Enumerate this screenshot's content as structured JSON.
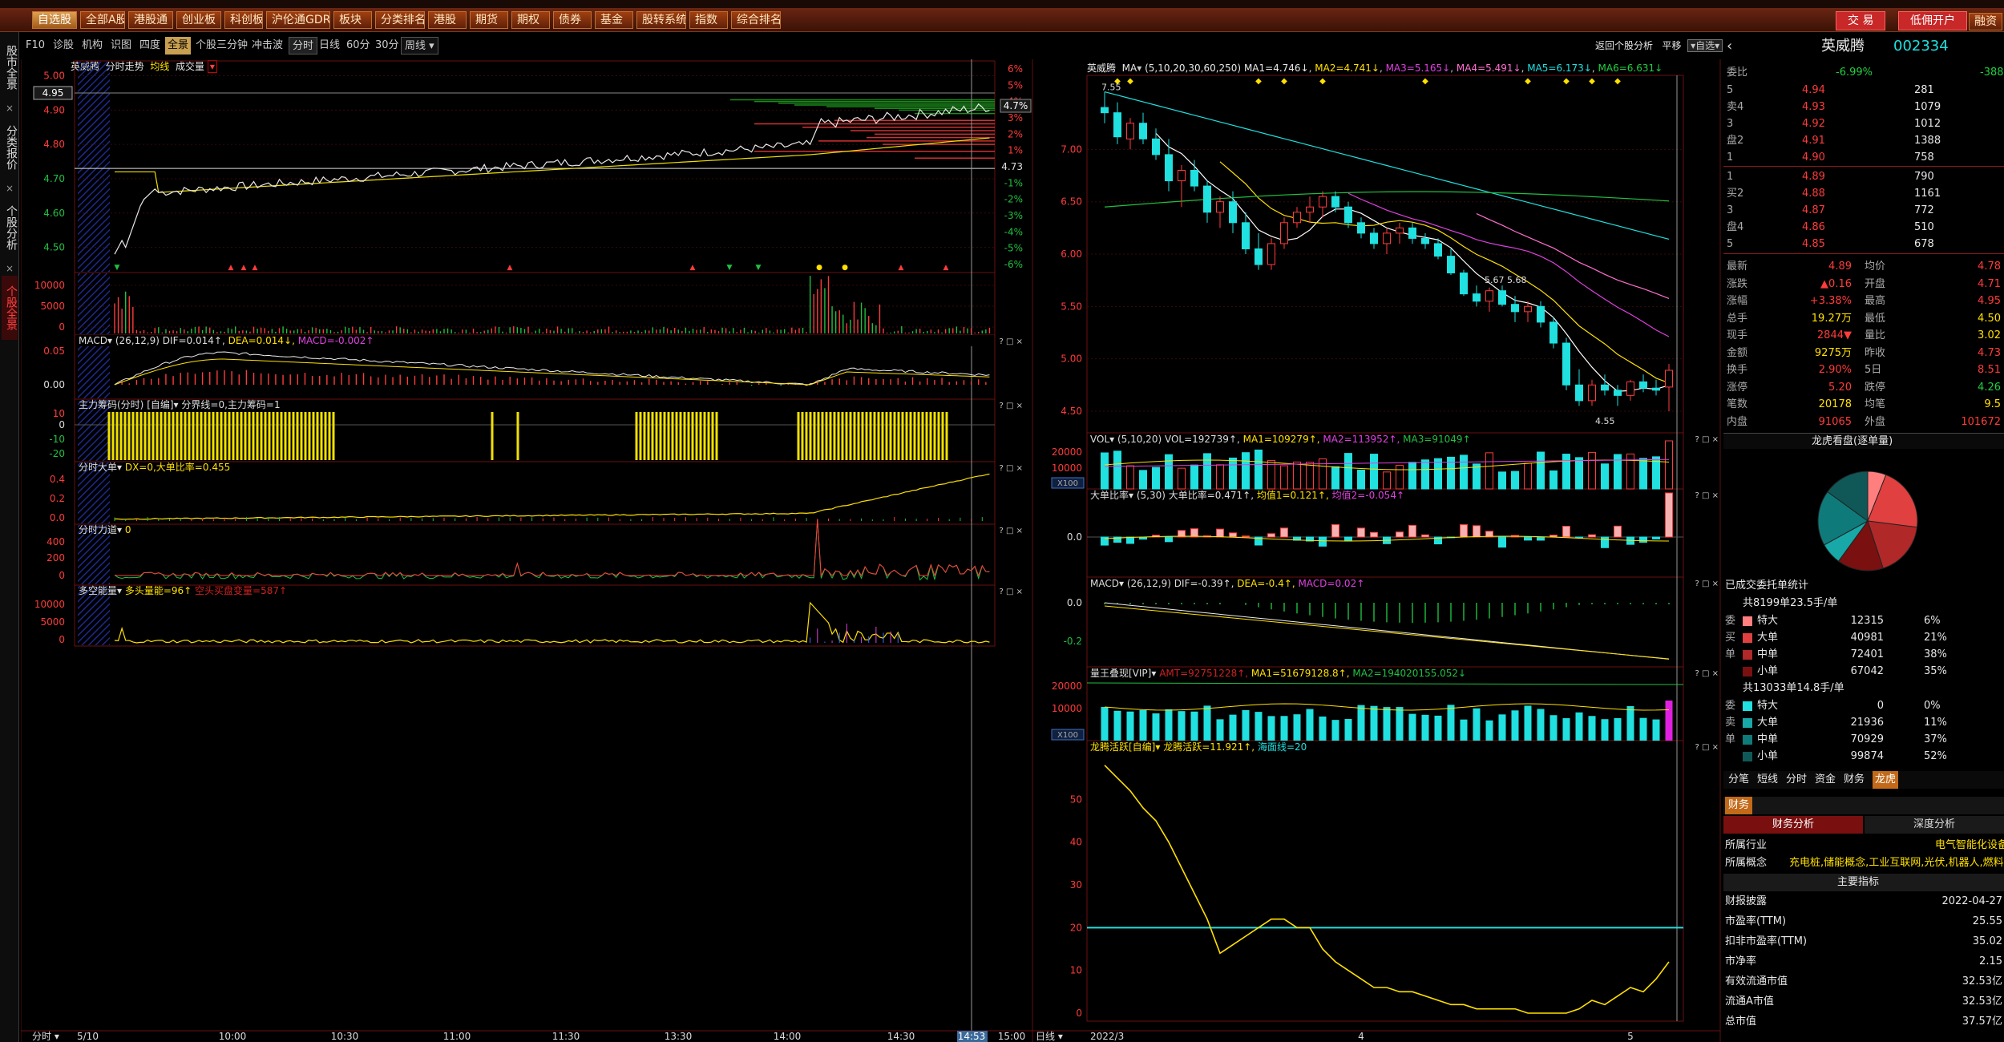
{
  "toolbar": {
    "items": [
      "自选股",
      "全部A股",
      "港股通",
      "创业板",
      "科创板",
      "沪伦通GDR",
      "板块",
      "分类排名",
      "港股",
      "期货",
      "期权",
      "债券",
      "基金",
      "股转系统",
      "指数",
      "综合排名"
    ],
    "trade": "交 易",
    "margin": "低佣开户",
    "right": "融资"
  },
  "leftside": {
    "tabs": [
      "股市全景",
      "分类报价",
      "个股分析",
      "个股全景"
    ]
  },
  "tabs": {
    "items": [
      "F10",
      "诊股",
      "机构",
      "识图",
      "四度",
      "全景",
      "个股三分钟",
      "冲击波"
    ],
    "periods": [
      "分时",
      "日线",
      "60分",
      "30分",
      "周线"
    ]
  },
  "intraday": {
    "title": {
      "name": "英威腾",
      "type": "分时走势",
      "avg": "均线",
      "vol": "成交量"
    },
    "left_ticks": [
      "5.00",
      "4.95",
      "4.90",
      "4.80",
      "4.70",
      "4.60",
      "4.50"
    ],
    "pct_ticks": [
      "6%",
      "5%",
      "4%",
      "3%",
      "2%",
      "1%",
      "4.73",
      "-1%",
      "-2%",
      "-3%",
      "-4%",
      "-5%",
      "-6%"
    ],
    "cur_price": "4.95",
    "cur_pct": "4.7%",
    "vol_ticks": [
      "10000",
      "5000",
      "0"
    ],
    "macd": {
      "name": "MACD",
      "params": "(26,12,9)",
      "dif": "DIF=0.014↑",
      "dea": "DEA=0.014↓",
      "macd": "MACD=-0.002↑",
      "ticks": [
        "0.05",
        "0.00"
      ]
    },
    "zlcm": {
      "name": "主力筹码(分时)",
      "badge": "[自编]",
      "text": "分界线=0,主力筹码=1",
      "ticks": [
        "10",
        "0",
        "-10",
        "-20"
      ]
    },
    "fsdd": {
      "name": "分时大单",
      "text": "DX=0,大单比率=0.455",
      "ticks": [
        "0.4",
        "0.2",
        "0.0"
      ]
    },
    "fsld": {
      "name": "分时力道",
      "text": "0",
      "ticks": [
        "400",
        "200",
        "0"
      ]
    },
    "dkn": {
      "name": "多空能量",
      "t1": "多头量能=96↑",
      "t2": "空头买盘变量=587↑",
      "ticks": [
        "10000",
        "5000",
        "0"
      ]
    },
    "time_ticks": [
      "分时",
      "5/10",
      "10:00",
      "10:30",
      "11:00",
      "11:30",
      "13:30",
      "14:00",
      "14:30",
      "14:53",
      "15:00"
    ]
  },
  "daily": {
    "ma": {
      "name": "英威腾",
      "label": "MA",
      "params": "(5,10,20,30,60,250)",
      "v": [
        "MA1=4.746↓",
        "MA2=4.741↓",
        "MA3=5.165↓",
        "MA4=5.491↓",
        "MA5=6.173↓",
        "MA6=6.631↓"
      ]
    },
    "right_title": {
      "back": "返回个股分析",
      "flat": "平移",
      "pick": "自选"
    },
    "price_ticks": [
      "7.00",
      "6.50",
      "6.00",
      "5.50",
      "5.00",
      "4.50"
    ],
    "hi_label": "7.55",
    "mark_label": "5.67  5.68",
    "lo_label": "4.55",
    "vol": {
      "name": "VOL",
      "params": "(5,10,20)",
      "v": [
        "VOL=192739↑",
        "MA1=109279↑",
        "MA2=113952↑",
        "MA3=91049↑"
      ],
      "ticks": [
        "20000",
        "10000",
        "0"
      ],
      "unit": "X100"
    },
    "ddbl": {
      "name": "大单比率",
      "params": "(5,30)",
      "v": [
        "大单比率=0.471↑",
        "均值1=0.121↑",
        "均值2=-0.054↑"
      ],
      "tick": "0.0"
    },
    "macd": {
      "name": "MACD",
      "params": "(26,12,9)",
      "v": [
        "DIF=-0.39↑",
        "DEA=-0.4↑",
        "MACD=0.02↑"
      ],
      "ticks": [
        "0.0",
        "-0.2"
      ]
    },
    "lwjx": {
      "name": "量王叠现[VIP]",
      "v": [
        "AMT=92751228↑",
        "MA1=51679128.8↑",
        "MA2=194020155.052↓"
      ],
      "ticks": [
        "20000",
        "10000"
      ],
      "unit": "X100"
    },
    "lthy": {
      "name": "龙腾活跃[自编]",
      "v": [
        "龙腾活跃=11.921↑",
        "海面线=20"
      ],
      "ticks": [
        "50",
        "40",
        "30",
        "20",
        "10",
        "0"
      ]
    },
    "date_ticks": [
      "日线",
      "2022/3",
      "4",
      "5"
    ]
  },
  "rp": {
    "name": "英威腾",
    "code": "002334",
    "weibi_label": "委比",
    "weibi": "-6.99%",
    "weicha": "-388",
    "sell": [
      [
        "5",
        "4.94",
        "281"
      ],
      [
        "4",
        "4.93",
        "1079"
      ],
      [
        "3",
        "4.92",
        "1012"
      ],
      [
        "2",
        "4.91",
        "1388"
      ],
      [
        "1",
        "4.90",
        "758"
      ]
    ],
    "buy": [
      [
        "1",
        "4.89",
        "790"
      ],
      [
        "2",
        "4.88",
        "1161"
      ],
      [
        "3",
        "4.87",
        "772"
      ],
      [
        "4",
        "4.86",
        "510"
      ],
      [
        "5",
        "4.85",
        "678"
      ]
    ],
    "sell_label": "卖",
    "pan_label": "盘",
    "buy_label": "买",
    "stats": [
      [
        "最新",
        "4.89",
        "均价",
        "4.78"
      ],
      [
        "涨跌",
        "▲0.16",
        "开盘",
        "4.71"
      ],
      [
        "涨幅",
        "+3.38%",
        "最高",
        "4.95"
      ],
      [
        "总手",
        "19.27万",
        "最低",
        "4.50"
      ],
      [
        "现手",
        "2844▼",
        "量比",
        "3.02"
      ],
      [
        "金额",
        "9275万",
        "昨收",
        "4.73"
      ],
      [
        "换手",
        "2.90%",
        "5日",
        "8.51"
      ],
      [
        "涨停",
        "5.20",
        "跌停",
        "4.26"
      ],
      [
        "笔数",
        "20178",
        "均笔",
        "9.5"
      ],
      [
        "内盘",
        "91065",
        "外盘",
        "101672"
      ]
    ],
    "pie_title": "龙虎看盘(逐单量)",
    "deal_title": "已成交委托单统计",
    "g1": {
      "head": "共8199单23.5手/单",
      "rows": [
        [
          "特大",
          "12315",
          "6%"
        ],
        [
          "大单",
          "40981",
          "21%"
        ],
        [
          "中单",
          "72401",
          "38%"
        ],
        [
          "小单",
          "67042",
          "35%"
        ]
      ],
      "side": [
        "委",
        "买",
        "单"
      ]
    },
    "g2": {
      "head": "共13033单14.8手/单",
      "rows": [
        [
          "特大",
          "0",
          "0%"
        ],
        [
          "大单",
          "21936",
          "11%"
        ],
        [
          "中单",
          "70929",
          "37%"
        ],
        [
          "小单",
          "99874",
          "52%"
        ]
      ],
      "side": [
        "委",
        "卖",
        "单"
      ]
    },
    "sub_tabs": [
      "分笔",
      "短线",
      "分时",
      "资金",
      "财务",
      "龙虎"
    ],
    "fin_tab": "财务",
    "fa_tabs": [
      "财务分析",
      "深度分析"
    ],
    "industry": [
      "所属行业",
      "电气智能化设备"
    ],
    "concept": [
      "所属概念",
      "充电桩,储能概念,工业互联网,光伏,机器人,燃料电池"
    ],
    "key_title": "主要指标",
    "kv": [
      [
        "财报披露",
        "2022-04-27"
      ],
      [
        "市盈率(TTM)",
        "25.55"
      ],
      [
        "扣非市盈率(TTM)",
        "35.02"
      ],
      [
        "市净率",
        "2.15"
      ],
      [
        "有效流通市值",
        "32.53亿"
      ],
      [
        "流通A市值",
        "32.53亿"
      ],
      [
        "总市值",
        "37.57亿"
      ]
    ]
  }
}
